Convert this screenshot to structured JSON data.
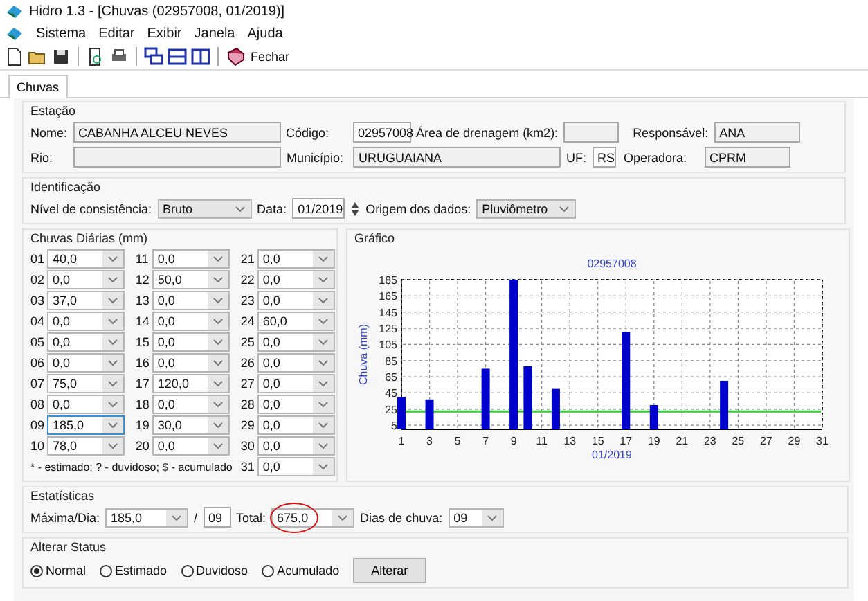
{
  "window": {
    "title": "Hidro 1.3  - [Chuvas (02957008, 01/2019)]"
  },
  "menu": [
    "Sistema",
    "Editar",
    "Exibir",
    "Janela",
    "Ajuda"
  ],
  "toolbar": {
    "close_label": "Fechar"
  },
  "tabs": [
    {
      "label": "Chuvas",
      "selected": true
    }
  ],
  "station": {
    "title": "Estação",
    "name": {
      "label": "Nome:",
      "value": "CABANHA ALCEU NEVES"
    },
    "code": {
      "label": "Código:",
      "value": "02957008"
    },
    "area": {
      "label": "Área de drenagem (km2):"
    },
    "responsible": {
      "label": "Responsável:",
      "value": "ANA"
    },
    "river": {
      "label": "Rio:"
    },
    "city": {
      "label": "Município:",
      "value": "URUGUAIANA"
    },
    "state": {
      "label": "UF:",
      "value": "RS"
    },
    "operator": {
      "label": "Operadora:",
      "value": "CPRM"
    }
  },
  "identification": {
    "title": "Identificação",
    "level": {
      "label": "Nível de consistência:",
      "value": "Bruto"
    },
    "date": {
      "label": "Data:",
      "value": "01/2019"
    },
    "origin": {
      "label": "Origem dos dados:",
      "value": "Pluviômetro"
    }
  },
  "daily": {
    "title": "Chuvas Diárias (mm)",
    "legend": "* - estimado; ? - duvidoso; $ - acumulado",
    "days": [
      {
        "day": "01",
        "value": "40,0",
        "selected": false
      },
      {
        "day": "02",
        "value": "0,0",
        "selected": false
      },
      {
        "day": "03",
        "value": "37,0",
        "selected": false
      },
      {
        "day": "04",
        "value": "0,0",
        "selected": false
      },
      {
        "day": "05",
        "value": "0,0",
        "selected": false
      },
      {
        "day": "06",
        "value": "0,0",
        "selected": false
      },
      {
        "day": "07",
        "value": "75,0",
        "selected": false
      },
      {
        "day": "08",
        "value": "0,0",
        "selected": false
      },
      {
        "day": "09",
        "value": "185,0",
        "selected": true
      },
      {
        "day": "10",
        "value": "78,0",
        "selected": false
      },
      {
        "day": "11",
        "value": "0,0",
        "selected": false
      },
      {
        "day": "12",
        "value": "50,0",
        "selected": false
      },
      {
        "day": "13",
        "value": "0,0",
        "selected": false
      },
      {
        "day": "14",
        "value": "0,0",
        "selected": false
      },
      {
        "day": "15",
        "value": "0,0",
        "selected": false
      },
      {
        "day": "16",
        "value": "0,0",
        "selected": false
      },
      {
        "day": "17",
        "value": "120,0",
        "selected": false
      },
      {
        "day": "18",
        "value": "0,0",
        "selected": false
      },
      {
        "day": "19",
        "value": "30,0",
        "selected": false
      },
      {
        "day": "20",
        "value": "0,0",
        "selected": false
      },
      {
        "day": "21",
        "value": "0,0",
        "selected": false
      },
      {
        "day": "22",
        "value": "0,0",
        "selected": false
      },
      {
        "day": "23",
        "value": "0,0",
        "selected": false
      },
      {
        "day": "24",
        "value": "60,0",
        "selected": false
      },
      {
        "day": "25",
        "value": "0,0",
        "selected": false
      },
      {
        "day": "26",
        "value": "0,0",
        "selected": false
      },
      {
        "day": "27",
        "value": "0,0",
        "selected": false
      },
      {
        "day": "28",
        "value": "0,0",
        "selected": false
      },
      {
        "day": "29",
        "value": "0,0",
        "selected": false
      },
      {
        "day": "30",
        "value": "0,0",
        "selected": false
      },
      {
        "day": "31",
        "value": "0,0",
        "selected": false
      }
    ]
  },
  "chart": {
    "title": "Gráfico",
    "chart_data": {
      "type": "bar",
      "title": "02957008",
      "xlabel": "01/2019",
      "ylabel": "Chuva (mm)",
      "x": [
        1,
        2,
        3,
        4,
        5,
        6,
        7,
        8,
        9,
        10,
        11,
        12,
        13,
        14,
        15,
        16,
        17,
        18,
        19,
        20,
        21,
        22,
        23,
        24,
        25,
        26,
        27,
        28,
        29,
        30,
        31
      ],
      "series": [
        {
          "color": "#0000cc",
          "values": [
            40,
            0,
            37,
            0,
            0,
            0,
            75,
            0,
            185,
            78,
            0,
            50,
            0,
            0,
            0,
            0,
            120,
            0,
            30,
            0,
            0,
            0,
            0,
            60,
            0,
            0,
            0,
            0,
            0,
            0,
            0
          ]
        }
      ],
      "xlim": [
        1,
        31
      ],
      "ylim": [
        0,
        185
      ],
      "grid": true,
      "xticks": [
        1,
        3,
        5,
        7,
        9,
        11,
        13,
        15,
        17,
        19,
        21,
        23,
        25,
        27,
        29,
        31
      ],
      "yticks": [
        5,
        25,
        45,
        65,
        85,
        105,
        125,
        145,
        165,
        185
      ],
      "ref_lines": [
        {
          "axis": "y",
          "value": 22,
          "color": "#33cc33"
        }
      ]
    }
  },
  "statistics": {
    "title": "Estatísticas",
    "max": {
      "label": "Máxima/Dia:",
      "value": "185,0"
    },
    "separator": "/",
    "max_day": "09",
    "total": {
      "label": "Total:",
      "value": "675,0",
      "circled": true
    },
    "rain_days": {
      "label": "Dias de chuva:",
      "value": "09"
    }
  },
  "status": {
    "title": "Alterar Status",
    "options": [
      {
        "label": "Normal",
        "selected": true
      },
      {
        "label": "Estimado",
        "selected": false
      },
      {
        "label": "Duvidoso",
        "selected": false
      },
      {
        "label": "Acumulado",
        "selected": false
      }
    ],
    "button": "Alterar"
  }
}
